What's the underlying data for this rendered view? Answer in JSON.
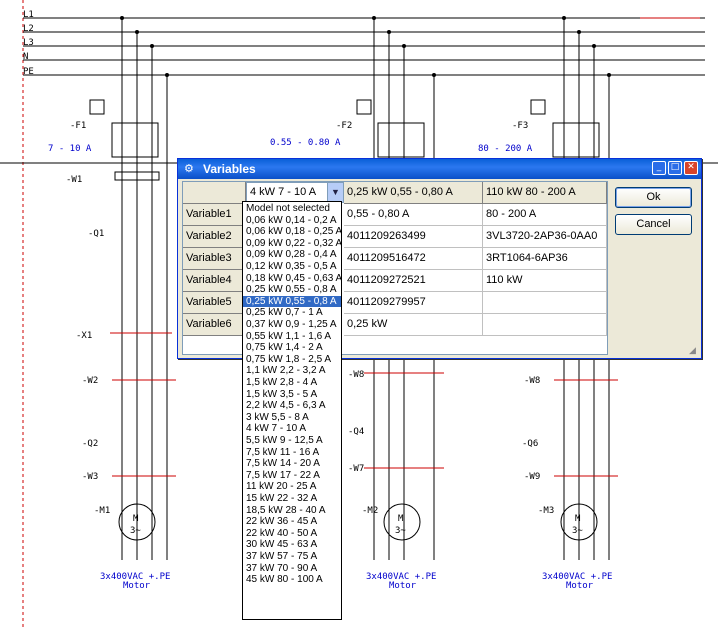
{
  "schematic": {
    "bus_labels": [
      "L1",
      "L2",
      "L3",
      "N",
      "PE"
    ],
    "feeders": [
      {
        "fuse_tag": "-F1",
        "fuse_range": "7 - 10 A",
        "cable_tag": "-W1",
        "switch_tag": "-Q1",
        "terminal_tag": "-X1",
        "cable2_tag": "-W2",
        "contactor_tag": "-Q2",
        "cable3_tag": "-W3",
        "motor_tag": "-M1",
        "motor_symbol": "M",
        "motor_phase": "3~",
        "supply": "3x400VAC +.PE",
        "supply_sub": "Motor"
      },
      {
        "fuse_tag": "-F2",
        "fuse_range": "0.55 - 0.80 A",
        "cable2_tag": "-W8",
        "contactor_tag": "-Q4",
        "cable3_tag": "-W7",
        "motor_tag": "-M2",
        "motor_symbol": "M",
        "motor_phase": "3~",
        "supply": "3x400VAC +.PE",
        "supply_sub": "Motor"
      },
      {
        "fuse_tag": "-F3",
        "fuse_range": "80 - 200 A",
        "cable2_tag": "-W8",
        "contactor_tag": "-Q6",
        "cable3_tag": "-W9",
        "motor_tag": "-M3",
        "motor_symbol": "M",
        "motor_phase": "3~",
        "supply": "3x400VAC +.PE",
        "supply_sub": "Motor"
      }
    ]
  },
  "dialog": {
    "title": "Variables",
    "title_icon": "app-icon",
    "buttons": {
      "ok": "Ok",
      "cancel": "Cancel",
      "minimize": "_",
      "maximize": "□",
      "close": "✕"
    },
    "combo_value": "4 kW 7 - 10 A",
    "combo_arrow_icon": "chevron-down-icon",
    "columns": [
      "4 kW 7 - 10 A",
      "0,25 kW 0,55 - 0,80 A",
      "110 kW 80 - 200 A"
    ],
    "rows": [
      {
        "label": "Variable1",
        "values": [
          "",
          "0,55 - 0,80 A",
          "80 - 200 A"
        ]
      },
      {
        "label": "Variable2",
        "values": [
          "",
          "4011209263499",
          "3VL3720-2AP36-0AA0"
        ]
      },
      {
        "label": "Variable3",
        "values": [
          "",
          "4011209516472",
          "3RT1064-6AP36"
        ]
      },
      {
        "label": "Variable4",
        "values": [
          "",
          "4011209272521",
          "110 kW"
        ]
      },
      {
        "label": "Variable5",
        "values": [
          "",
          "4011209279957",
          ""
        ]
      },
      {
        "label": "Variable6",
        "values": [
          "",
          "0,25 kW",
          ""
        ]
      }
    ]
  },
  "dropdown": {
    "selected_index": 9,
    "options": [
      "Model not selected",
      "0,06 kW 0,14 - 0,2 A",
      "0,06 kW 0,18 - 0,25 A",
      "0,09 kW 0,22 - 0,32 A",
      "0,09 kW 0,28 - 0,4 A",
      "0,12 kW 0,35 - 0,5 A",
      "0,18 kW 0,45 - 0,63 A",
      "0,25 kW 0,55 - 0,8 A",
      "0,25 kW 0,55 - 0,8 A",
      "0,25 kW 0,7 - 1 A",
      "0,37 kW 0,9 - 1,25 A",
      "0,55 kW 1,1 - 1,6 A",
      "0,75 kW 1,4 - 2 A",
      "0,75 kW 1,8 - 2,5 A",
      "1,1 kW 2,2 - 3,2 A",
      "1,5 kW 2,8 - 4 A",
      "1,5 kW 3,5 - 5 A",
      "2,2 kW 4,5 - 6,3 A",
      "3 kW 5,5 - 8 A",
      "4 kW 7 - 10 A",
      "5,5 kW 9 - 12,5 A",
      "7,5 kW 11 - 16 A",
      "7,5 kW 14 - 20 A",
      "7,5 kW 17 - 22 A",
      "11 kW 20 - 25 A",
      "15 kW 22 - 32 A",
      "18,5 kW 28 - 40 A",
      "22 kW 36 - 45 A",
      "22 kW 40 - 50 A",
      "30 kW 45 - 63 A",
      "37 kW 57 - 75 A",
      "37 kW 70 - 90 A",
      "45 kW 80 - 100 A"
    ]
  }
}
